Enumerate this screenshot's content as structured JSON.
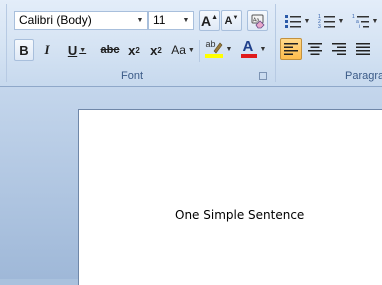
{
  "ribbon": {
    "font_group": {
      "font_name": "Calibri (Body)",
      "font_size": "11",
      "grow_font_label": "A",
      "shrink_font_label": "A",
      "bold_label": "B",
      "italic_label": "I",
      "underline_label": "U",
      "strike_label": "abc",
      "subscript_label": "x",
      "subscript_sub": "2",
      "superscript_label": "x",
      "superscript_sup": "2",
      "change_case_label": "Aa",
      "highlight_label": "ab",
      "font_color_label": "A",
      "group_label": "Font",
      "highlight_color": "#ffff00",
      "font_color": "#e01b1b"
    },
    "paragraph_group": {
      "group_label": "Paragra"
    },
    "colors": {
      "active_align": "#ffbd4c"
    }
  },
  "document": {
    "text": "One Simple Sentence"
  }
}
